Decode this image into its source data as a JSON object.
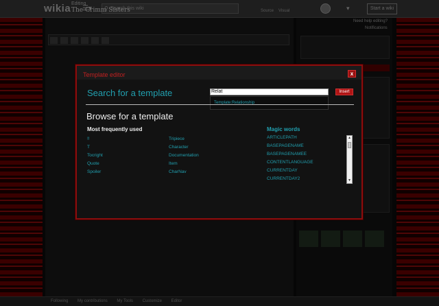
{
  "topbar": {
    "logo": "wikia",
    "search_placeholder": "Search this wiki"
  },
  "editor": {
    "editing_label": "Editing",
    "page_title": "The Grimm Sisters",
    "mode_source": "Source",
    "mode_visual": "Visual",
    "rightcol": {
      "help": "Need help editing?",
      "notifications": "Notifications"
    },
    "bottombar": {
      "items": [
        "Following",
        "My contributions",
        "My Tools",
        "Customize",
        "Editor"
      ]
    }
  },
  "modal": {
    "title": "Template editor",
    "close_label": "x",
    "search_heading": "Search for a template",
    "search_value": "Relat",
    "insert_label": "Insert",
    "suggestion": "Template:Relationship",
    "browse_heading": "Browse for a template",
    "most_frequent_heading": "Most frequently used",
    "frequent_col1": [
      "!!",
      "T",
      "Tocright",
      "Quote",
      "Spoiler"
    ],
    "frequent_col2": [
      "Tripiece",
      "Character",
      "Documentation",
      "Item",
      "CharNav"
    ],
    "magic_heading": "Magic words",
    "magic_words": [
      "ARTICLEPATH",
      "BASEPAGENAME",
      "BASEPAGENAMEE",
      "CONTENTLANGUAGE",
      "CURRENTDAY",
      "CURRENTDAY2"
    ]
  },
  "colors": {
    "accent_red": "#b01515",
    "link_teal": "#21a0b0"
  }
}
